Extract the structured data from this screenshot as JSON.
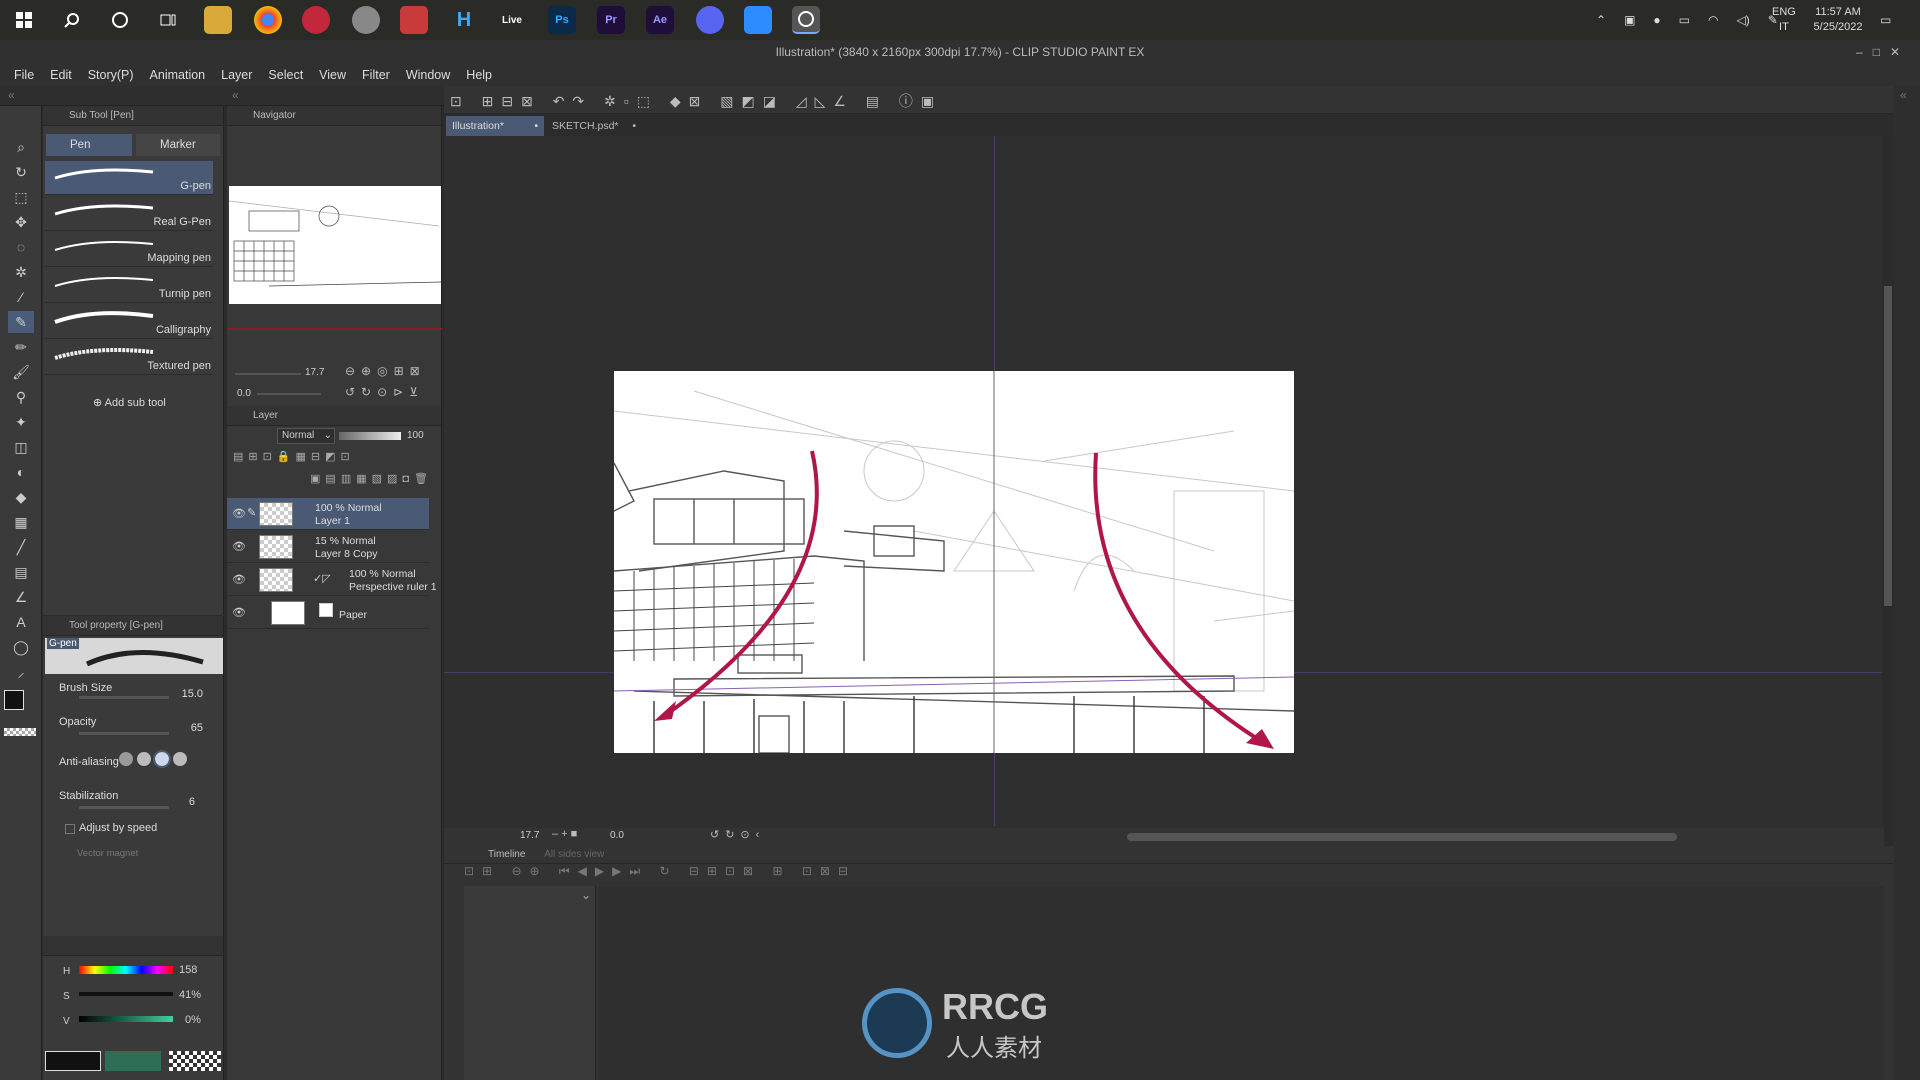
{
  "taskbar": {
    "apps": [
      {
        "icon": "windows-start-icon"
      },
      {
        "icon": "search-icon"
      },
      {
        "icon": "cortana-icon"
      },
      {
        "icon": "task-view-icon"
      },
      {
        "icon": "file-explorer-icon"
      },
      {
        "icon": "chrome-icon"
      },
      {
        "icon": "app-icon"
      },
      {
        "icon": "app-icon"
      },
      {
        "icon": "app-icon"
      },
      {
        "icon": "houdini-icon",
        "label": "H"
      },
      {
        "icon": "live-icon",
        "label": "Live"
      },
      {
        "icon": "photoshop-icon",
        "label": "Ps"
      },
      {
        "icon": "premiere-icon",
        "label": "Pr"
      },
      {
        "icon": "after-effects-icon",
        "label": "Ae"
      },
      {
        "icon": "app-icon"
      },
      {
        "icon": "zoom-icon"
      },
      {
        "icon": "clip-studio-icon"
      }
    ],
    "lang": "ENG",
    "lang2": "IT",
    "time": "11:57 AM",
    "date": "5/25/2022"
  },
  "window": {
    "title": "Illustration* (3840 x 2160px 300dpi 17.7%) - CLIP STUDIO PAINT EX"
  },
  "menu": [
    "File",
    "Edit",
    "Story(P)",
    "Animation",
    "Layer",
    "Select",
    "View",
    "Filter",
    "Window",
    "Help"
  ],
  "subtool": {
    "header": "Sub Tool [Pen]",
    "tabs": [
      "Pen",
      "Marker"
    ],
    "brushes": [
      "G-pen",
      "Real G-Pen",
      "Mapping pen",
      "Turnip pen",
      "Calligraphy",
      "Textured pen"
    ],
    "add_label": "Add sub tool"
  },
  "navigator": {
    "header": "Navigator",
    "zoom": "17.7",
    "rotation": "0.0"
  },
  "toolprop": {
    "header": "Tool property [G-pen]",
    "preview_label": "G-pen",
    "brush_size_label": "Brush Size",
    "brush_size": "15.0",
    "opacity_label": "Opacity",
    "opacity": "65",
    "antialias_label": "Anti-aliasing",
    "stabilization_label": "Stabilization",
    "stabilization": "6",
    "adjust_label": "Adjust by speed",
    "vector_label": "Vector magnet"
  },
  "color": {
    "h_label": "H",
    "h": "158",
    "s_label": "S",
    "s": "41%",
    "v_label": "V",
    "v": "0%",
    "main": "#111111",
    "sub": "#2d6e55"
  },
  "layer": {
    "header": "Layer",
    "blend": "Normal",
    "opacity": "100",
    "rows": [
      {
        "line1": "100 % Normal",
        "line2": "Layer 1"
      },
      {
        "line1": "15 % Normal",
        "line2": "Layer 8 Copy"
      },
      {
        "line1": "100 % Normal",
        "line2": "Perspective ruler 1"
      },
      {
        "line1": "",
        "line2": "Paper"
      }
    ]
  },
  "tabs": [
    "Illustration*",
    "SKETCH.psd*"
  ],
  "canvas_status": {
    "zoom": "17.7",
    "rotation": "0.0"
  },
  "timeline": {
    "header": "Timeline",
    "subtab": "All sides view"
  },
  "watermark": {
    "text1": "RRCG",
    "text2": "人人素材"
  },
  "colors": {
    "accent": "#4b5a74",
    "arrow": "#b0164a",
    "guide": "#7a3f9a"
  }
}
